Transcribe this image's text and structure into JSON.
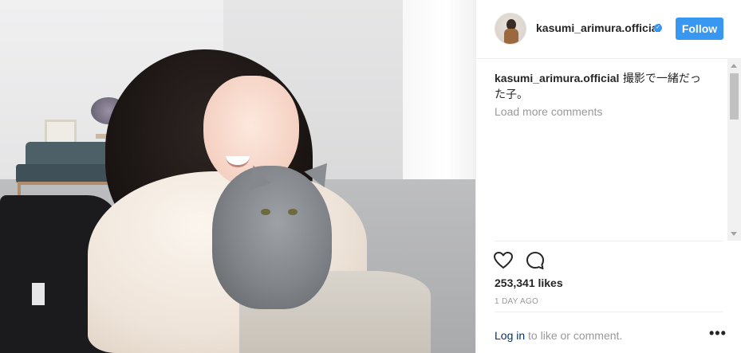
{
  "post": {
    "username": "kasumi_arimura.official",
    "follow_label": "Follow",
    "caption_user": "kasumi_arimura.official",
    "caption_text": " 撮影で一緒だった子。",
    "load_more_label": "Load more comments",
    "likes_text": "253,341 likes",
    "timestamp": "1 DAY AGO",
    "login_link": "Log in",
    "login_suffix": " to like or comment.",
    "more_options": "•••"
  },
  "icons": {
    "verified": "verified-badge-icon",
    "like": "heart-icon",
    "comment": "comment-bubble-icon",
    "more": "more-options-icon"
  },
  "colors": {
    "accent": "#3897f0",
    "link": "#003569",
    "muted": "#999999",
    "text": "#262626"
  }
}
